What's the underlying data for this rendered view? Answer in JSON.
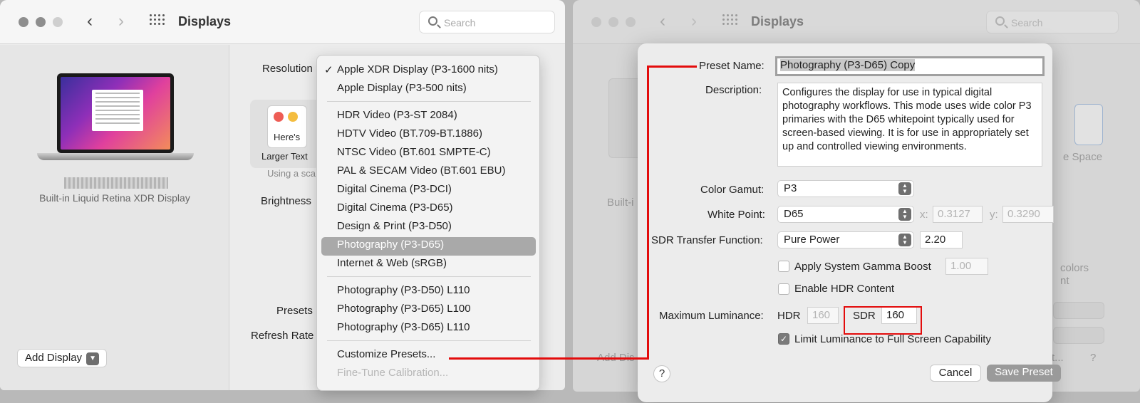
{
  "left_window": {
    "title": "Displays",
    "search_placeholder": "Search",
    "display_name": "Built-in Liquid Retina XDR Display",
    "add_display_label": "Add Display",
    "resolution_label": "Resolution",
    "thumb_text": "Here's",
    "larger_text_label": "Larger Text",
    "using_scaled_text": "Using a sca",
    "brightness_label": "Brightness",
    "presets_label": "Presets",
    "refresh_rate_label": "Refresh Rate"
  },
  "preset_menu": {
    "items": [
      {
        "label": "Apple XDR Display (P3-1600 nits)",
        "checked": true
      },
      {
        "label": "Apple Display (P3-500 nits)"
      },
      {
        "label": "HDR Video (P3-ST 2084)"
      },
      {
        "label": "HDTV Video (BT.709-BT.1886)"
      },
      {
        "label": "NTSC Video (BT.601 SMPTE-C)"
      },
      {
        "label": "PAL & SECAM Video (BT.601 EBU)"
      },
      {
        "label": "Digital Cinema (P3-DCI)"
      },
      {
        "label": "Digital Cinema (P3-D65)"
      },
      {
        "label": "Design & Print (P3-D50)"
      },
      {
        "label": "Photography (P3-D65)",
        "highlighted": true
      },
      {
        "label": "Internet & Web (sRGB)"
      },
      {
        "label": "Photography (P3-D50) L110"
      },
      {
        "label": "Photography (P3-D65) L100"
      },
      {
        "label": "Photography (P3-D65) L110"
      },
      {
        "label": "Customize Presets..."
      },
      {
        "label": "Fine-Tune Calibration...",
        "disabled": true
      }
    ]
  },
  "right_window": {
    "title": "Displays",
    "search_placeholder": "Search",
    "ghost_builtin": "Built-i",
    "ghost_space": "e Space",
    "ghost_colors": "colors",
    "ghost_nt": "nt",
    "ghost_add": "Add Dis",
    "ghost_t": "t...",
    "ghost_help": "?"
  },
  "preset_sheet": {
    "preset_name_label": "Preset Name:",
    "preset_name_value": "Photography (P3-D65) Copy",
    "description_label": "Description:",
    "description_value": "Configures the display for use in typical digital photography workflows. This mode uses wide color P3 primaries with the D65 whitepoint typically used for screen-based viewing. It is for use in appropriately set up and controlled viewing environments.",
    "color_gamut_label": "Color Gamut:",
    "color_gamut_value": "P3",
    "white_point_label": "White Point:",
    "white_point_value": "D65",
    "x_label": "x:",
    "x_value": "0.3127",
    "y_label": "y:",
    "y_value": "0.3290",
    "sdr_tf_label": "SDR Transfer Function:",
    "sdr_tf_value": "Pure Power",
    "gamma_value": "2.20",
    "gamma_boost_label": "Apply System Gamma Boost",
    "gamma_boost_checked": false,
    "gamma_boost_value": "1.00",
    "hdr_content_label": "Enable HDR Content",
    "hdr_content_checked": false,
    "max_lum_label": "Maximum Luminance:",
    "hdr_label": "HDR",
    "hdr_value": "160",
    "sdr_label": "SDR",
    "sdr_value": "160",
    "limit_lum_label": "Limit Luminance to Full Screen Capability",
    "limit_lum_checked": true,
    "help_label": "?",
    "cancel_label": "Cancel",
    "save_label": "Save Preset"
  },
  "colors": {
    "annotation_red": "#e30c0c",
    "menu_highlight": "#a9a9a9"
  }
}
